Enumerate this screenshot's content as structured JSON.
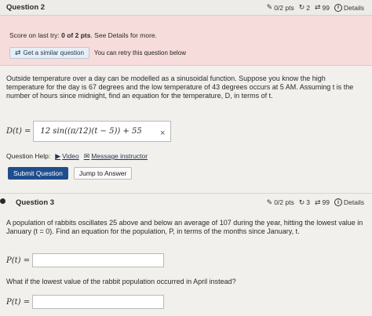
{
  "question2": {
    "title": "Question 2",
    "points": "0/2 pts",
    "retries": "2",
    "attempts": "99",
    "details": "Details"
  },
  "score": {
    "prefix": "Score on last try: ",
    "value": "0 of 2 pts",
    "suffix": ". See Details for more.",
    "similar_button": "Get a similar question",
    "retry_text": "You can retry this question below"
  },
  "q2_text": "Outside temperature over a day can be modelled as a sinusoidal function. Suppose you know the high temperature for the day is 67 degrees and the low temperature of 43 degrees occurs at 5 AM. Assuming t is the number of hours since midnight, find an equation for the temperature, D, in terms of t.",
  "q2_answer": {
    "label": "D(t) =",
    "value": "12 sin((π/12)(t − 5)) + 55",
    "clear": "×"
  },
  "help": {
    "label": "Question Help:",
    "video": "Video",
    "message": "Message instructor"
  },
  "buttons": {
    "submit": "Submit Question",
    "jump": "Jump to Answer"
  },
  "question3": {
    "title": "Question 3",
    "points": "0/2 pts",
    "retries": "3",
    "attempts": "99",
    "details": "Details"
  },
  "q3_text": "A population of rabbits oscillates 25 above and below an average of 107 during the year, hitting the lowest value in January (t = 0). Find an equation for the population, P, in terms of the months since January, t.",
  "q3_answer1": {
    "label": "P(t) ="
  },
  "q3_followup": "What if the lowest value of the rabbit population occurred in April instead?",
  "q3_answer2": {
    "label": "P(t) ="
  },
  "icons": {
    "edit": "✎",
    "retry": "↻",
    "attempts": "⇄",
    "info": "i",
    "video": "▶",
    "mail": "✉"
  }
}
